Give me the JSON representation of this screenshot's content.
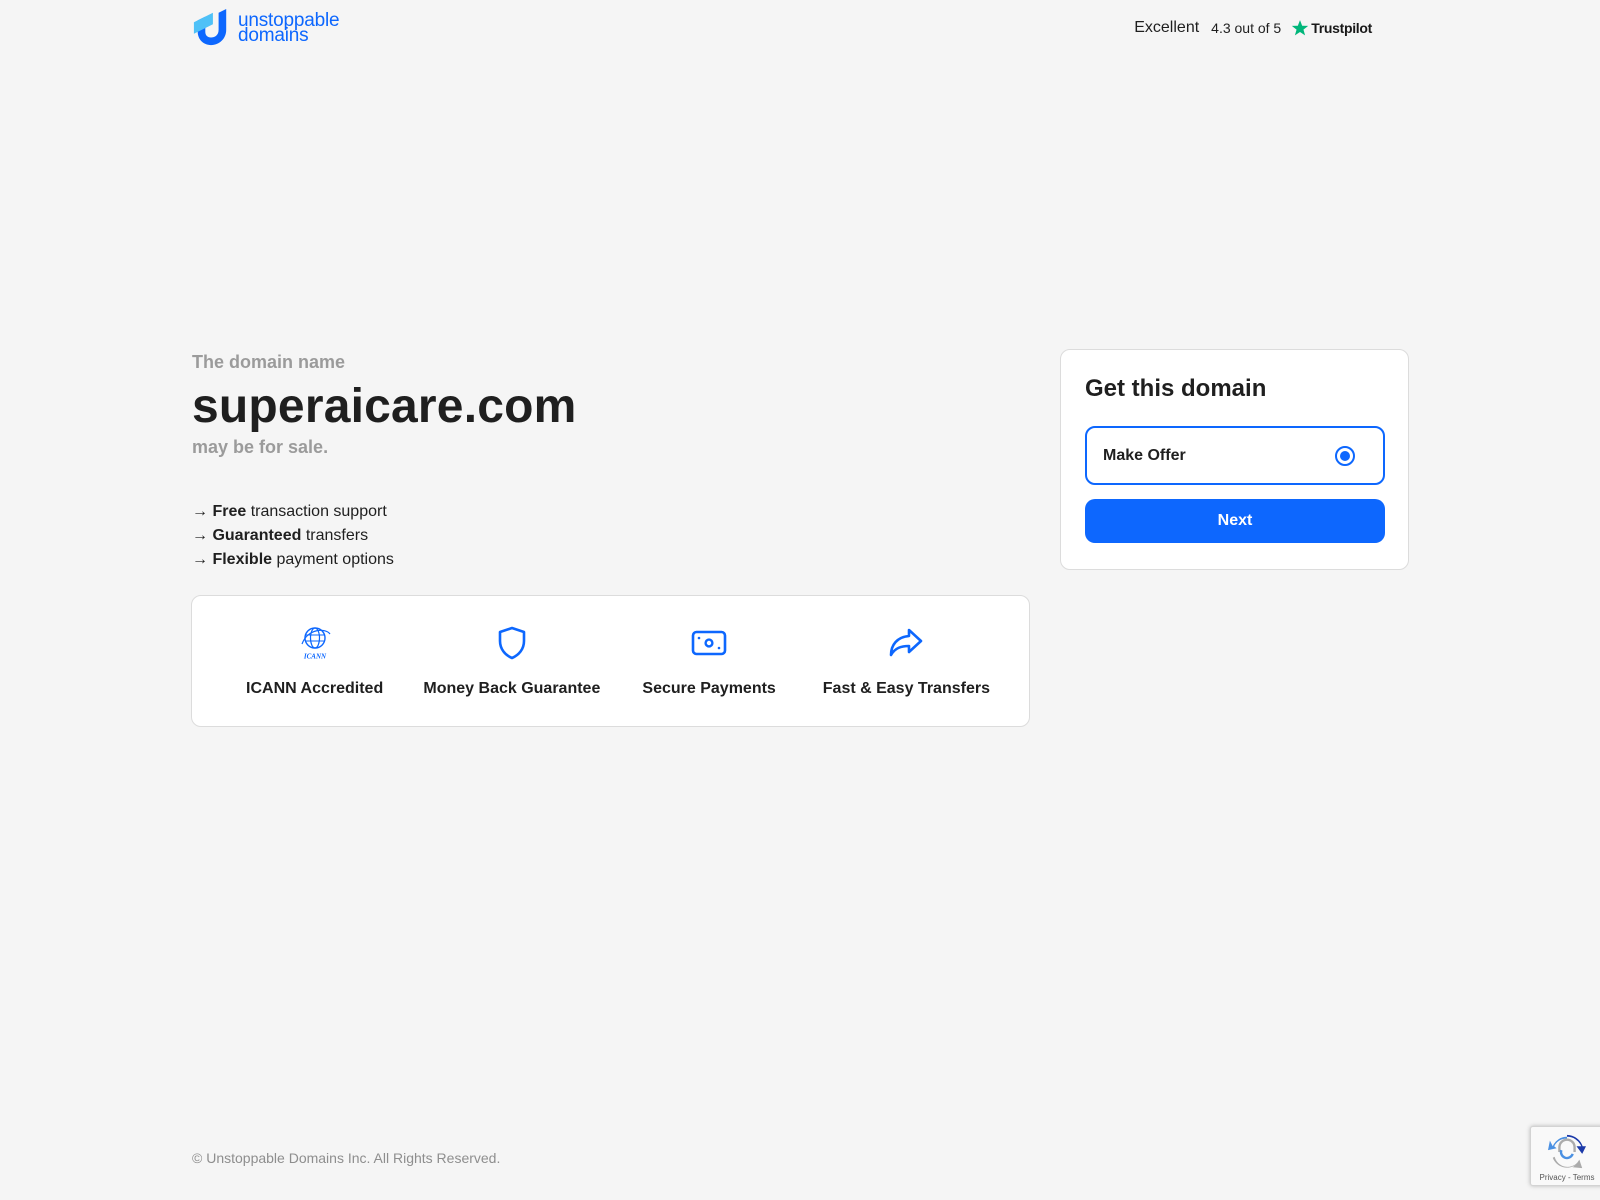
{
  "header": {
    "logo": {
      "line1": "unstoppable",
      "line2": "domains",
      "icon": "unstoppable-domains-logo-icon"
    },
    "trust": {
      "label": "Excellent",
      "rating": "4.3 out of 5",
      "brand": "Trustpilot",
      "icon": "trustpilot-star-icon"
    }
  },
  "hero": {
    "eyebrow": "The domain name",
    "domain": "superaicare.com",
    "subtitle": "may be for sale."
  },
  "features": [
    {
      "arrow": "→",
      "bold": "Free",
      "rest": " transaction support"
    },
    {
      "arrow": "→",
      "bold": "Guaranteed",
      "rest": " transfers"
    },
    {
      "arrow": "→",
      "bold": "Flexible",
      "rest": " payment options"
    }
  ],
  "badges": [
    {
      "label": "ICANN Accredited",
      "icon": "icann-globe-icon",
      "icon_text": "ICANN"
    },
    {
      "label": "Money Back Guarantee",
      "icon": "shield-icon"
    },
    {
      "label": "Secure Payments",
      "icon": "cash-icon"
    },
    {
      "label": "Fast & Easy Transfers",
      "icon": "share-arrow-icon"
    }
  ],
  "card": {
    "title": "Get this domain",
    "option": {
      "label": "Make Offer",
      "selected": true
    },
    "next_label": "Next"
  },
  "footer": {
    "copyright": "© Unstoppable Domains Inc. All Rights Reserved."
  },
  "recaptcha": {
    "links": "Privacy - Terms",
    "icon": "recaptcha-icon"
  },
  "colors": {
    "accent": "#0d67fe",
    "background": "#f5f5f5",
    "muted_text": "#9b9b9b",
    "trustpilot": "#00b67a"
  }
}
